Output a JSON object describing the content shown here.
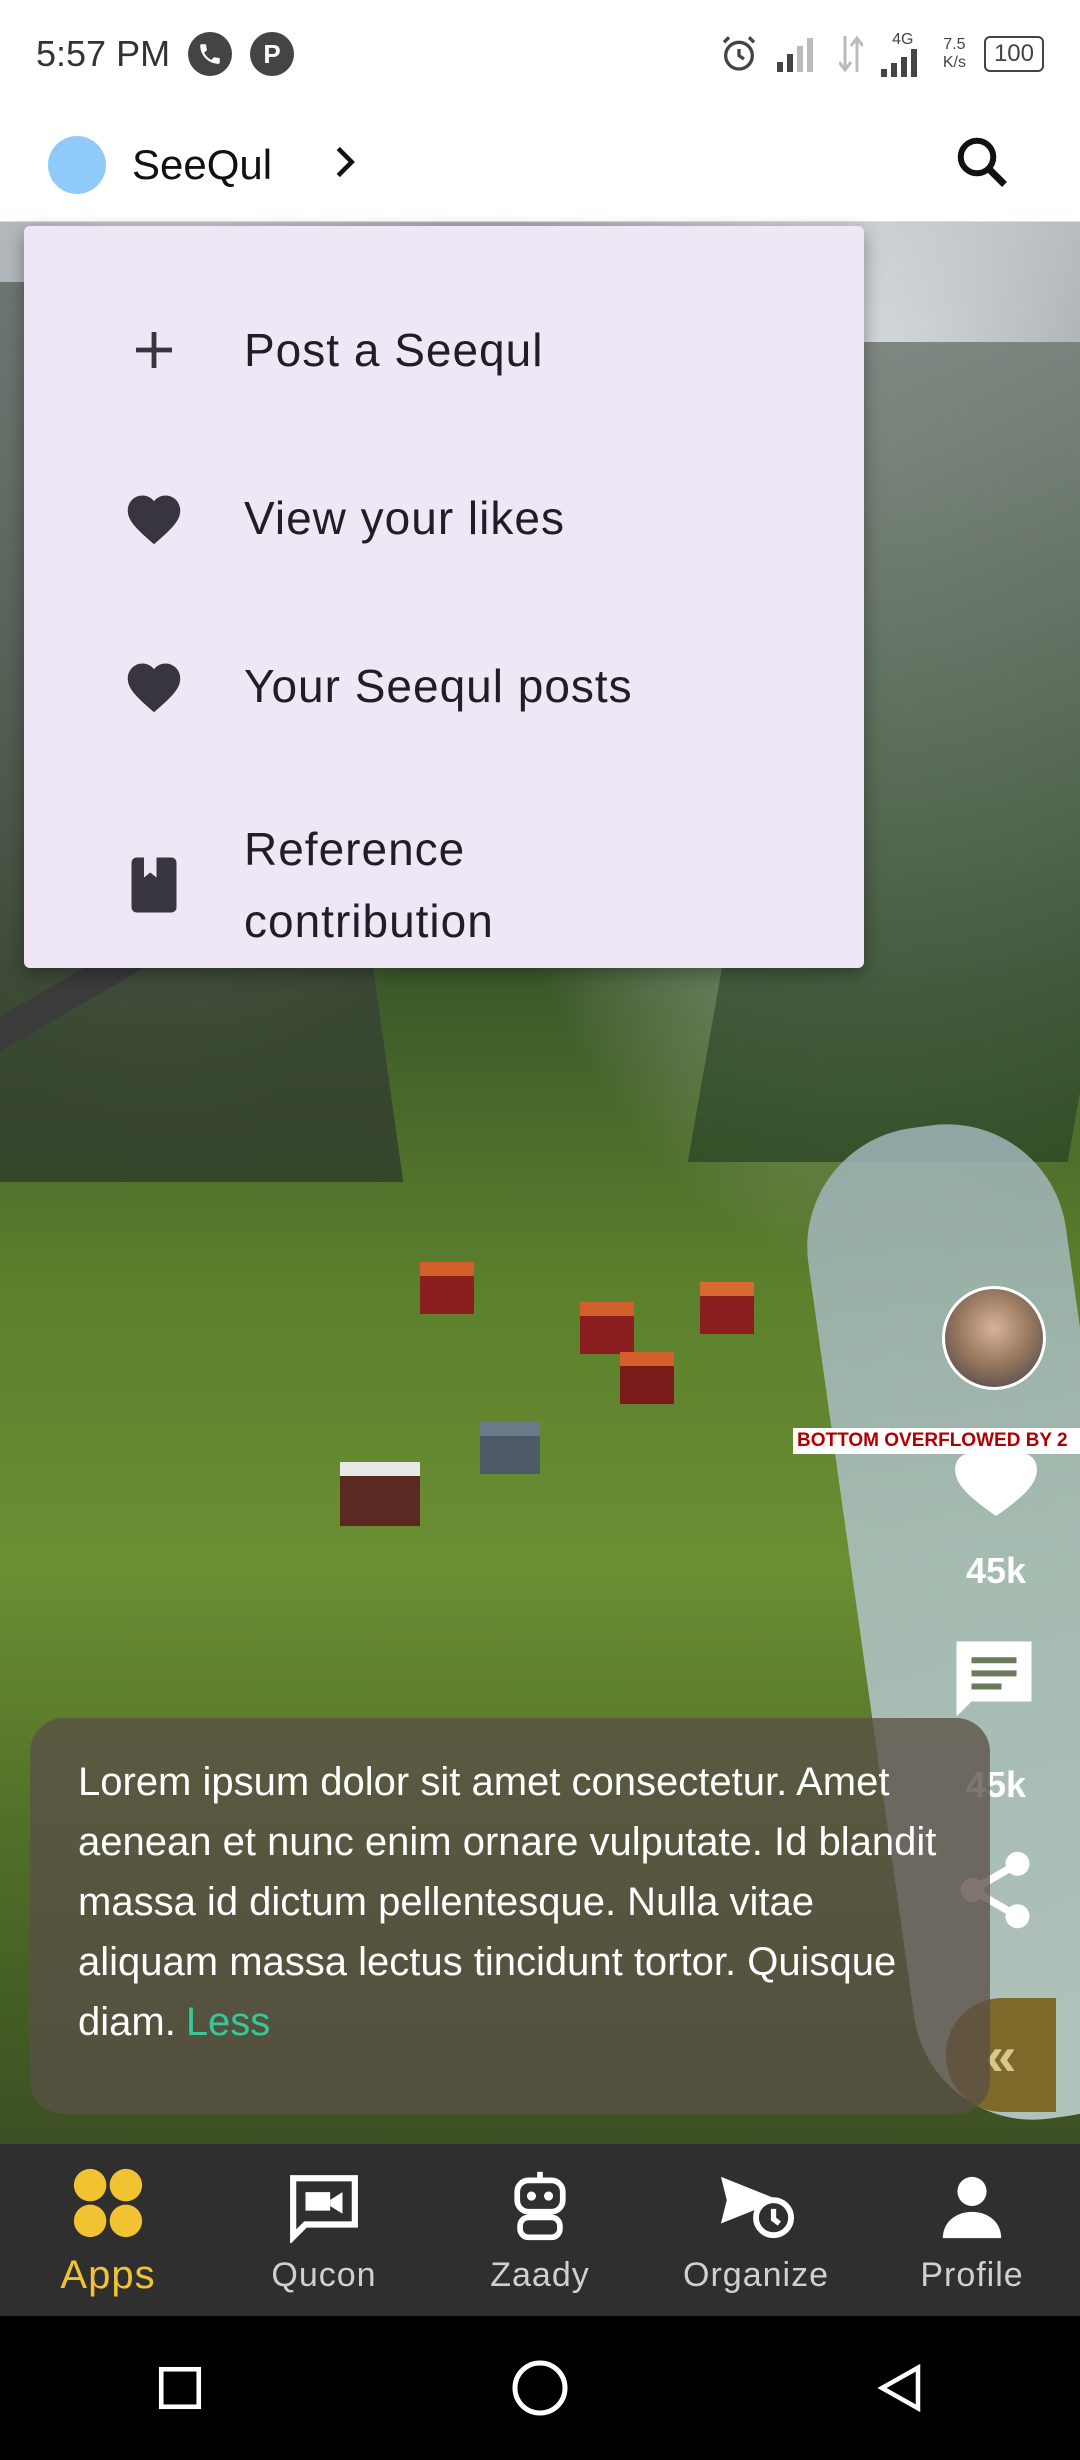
{
  "status_bar": {
    "time": "5:57 PM",
    "network": "4G",
    "speed_value": "7.5",
    "speed_unit": "K/s",
    "battery": "100"
  },
  "app_bar": {
    "title": "SeeQul",
    "avatar_color": "#90caf9"
  },
  "menu": {
    "items": [
      {
        "label": "Post a Seequl",
        "icon": "plus-icon"
      },
      {
        "label": "View your likes",
        "icon": "heart-icon"
      },
      {
        "label": "Your Seequl posts",
        "icon": "heart-icon"
      },
      {
        "label": "Reference contribution",
        "icon": "bookmark-icon"
      }
    ]
  },
  "rail": {
    "overflow_text": "BOTTOM OVERFLOWED BY 2",
    "likes_count": "45k",
    "comments_count": "45k",
    "collapse_label": "«"
  },
  "caption": {
    "text": "Lorem ipsum dolor sit amet consectetur. Amet aenean et nunc enim ornare vulputate. Id blandit massa id dictum pellentesque. Nulla vitae aliquam massa lectus tincidunt tortor. Quisque diam.",
    "less": "Less"
  },
  "bottom_nav": {
    "items": [
      {
        "label": "Apps",
        "icon": "apps-icon",
        "active": true
      },
      {
        "label": "Qucon",
        "icon": "video-chat-icon",
        "active": false
      },
      {
        "label": "Zaady",
        "icon": "robot-icon",
        "active": false
      },
      {
        "label": "Organize",
        "icon": "schedule-send-icon",
        "active": false
      },
      {
        "label": "Profile",
        "icon": "person-icon",
        "active": false
      }
    ],
    "active_color": "#f1c232"
  },
  "colors": {
    "menu_bg": "#efe7f5",
    "accent_green": "#36c79a"
  }
}
